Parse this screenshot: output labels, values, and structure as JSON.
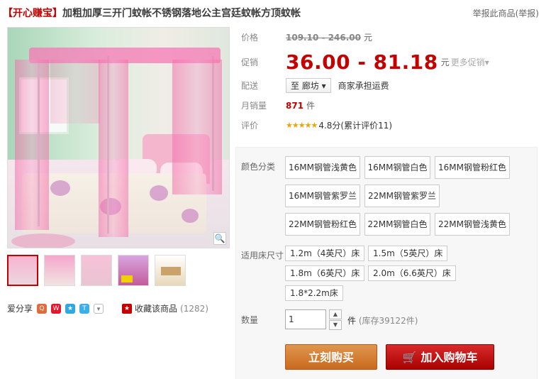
{
  "title": {
    "tag": "【开心赚宝】",
    "text": "加粗加厚三开门蚊帐不锈钢落地公主宫廷蚊帐方顶蚊帐"
  },
  "report": "举报此商品(举报)",
  "price": {
    "label": "价格",
    "original": "109.10 - 246.00",
    "unit": "元"
  },
  "promo": {
    "label": "促销",
    "price": "36.00 - 81.18",
    "unit": "元",
    "more": "更多促销"
  },
  "delivery": {
    "label": "配送",
    "to": "至 廊坊",
    "fee": "商家承担运费"
  },
  "monthly": {
    "label": "月销量",
    "count": "871",
    "unit": "件"
  },
  "rating": {
    "label": "评价",
    "stars": "★★★★★",
    "text": "4.8分(累计评价11)"
  },
  "color": {
    "label": "颜色分类",
    "options": [
      "16MM钢管浅黄色",
      "16MM钢管白色",
      "16MM钢管粉红色",
      "16MM钢管紫罗兰",
      "22MM钢管紫罗兰",
      "22MM钢管粉红色",
      "22MM钢管白色",
      "22MM钢管浅黄色"
    ]
  },
  "size": {
    "label": "适用床尺寸",
    "options": [
      "1.2m（4英尺）床",
      "1.5m（5英尺）床",
      "1.8m（6英尺）床",
      "2.0m（6.6英尺）床",
      "1.8*2.2m床"
    ]
  },
  "quantity": {
    "label": "数量",
    "value": "1",
    "unit": "件",
    "stock": "(库存39122件)"
  },
  "buttons": {
    "buy": "立刻购买",
    "cart": "加入购物车"
  },
  "share": {
    "label": "爱分享"
  },
  "favorite": {
    "label": "收藏该商品",
    "count": "(1282)"
  },
  "colors": {
    "accent": "#c40000",
    "buy": "#d07c2c",
    "cart": "#c40000"
  }
}
